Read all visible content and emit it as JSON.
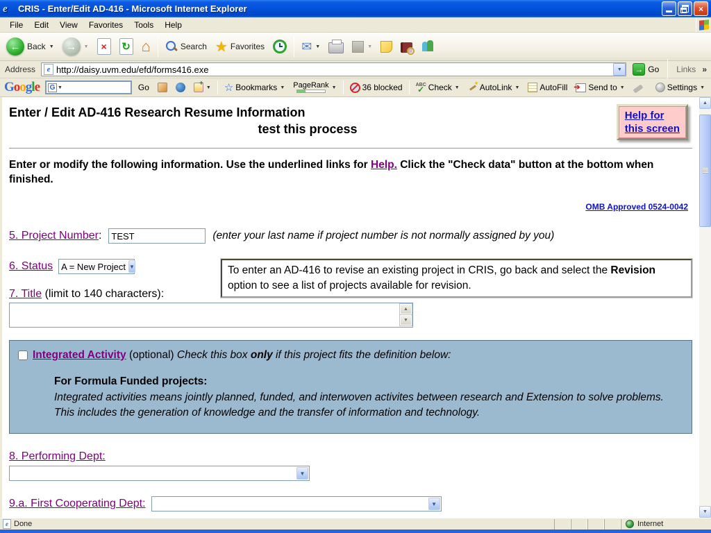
{
  "colors": {
    "titlebar_blue": "#0353dd",
    "chrome_tan": "#ece9d8",
    "link_blue": "#1111cc",
    "visited_purple": "#800080",
    "help_box_pink": "#ffcccc",
    "integrated_box_blue": "#9cbacf",
    "taskbar_blue": "#2663e0"
  },
  "window": {
    "title": "CRIS - Enter/Edit AD-416 - Microsoft Internet Explorer",
    "status_done": "Done",
    "status_zone": "Internet"
  },
  "menu": {
    "items": [
      "File",
      "Edit",
      "View",
      "Favorites",
      "Tools",
      "Help"
    ]
  },
  "toolbar": {
    "back_label": "Back",
    "search_label": "Search",
    "favorites_label": "Favorites"
  },
  "address": {
    "label": "Address",
    "url": "http://daisy.uvm.edu/efd/forms416.exe",
    "go_label": "Go",
    "links_label": "Links"
  },
  "google": {
    "logo_letters": [
      "G",
      "o",
      "o",
      "g",
      "l",
      "e"
    ],
    "favicon_letter": "G",
    "go_label": "Go",
    "bookmarks_label": "Bookmarks",
    "pagerank_label": "PageRank",
    "blocked_label": "36 blocked",
    "check_abc": "ABC",
    "check_label": "Check",
    "check_mark": "✓",
    "autolink_label": "AutoLink",
    "autofill_label": "AutoFill",
    "sendto_label": "Send to",
    "settings_label": "Settings"
  },
  "icons": {
    "ie_logo": "e",
    "close_x": "×",
    "back_arrow": "←",
    "forward_arrow": "→",
    "stop_x": "×",
    "refresh": "↻",
    "home": "⌂",
    "favorites_star": "★",
    "mail_envelope": "✉",
    "dropdown": "▼",
    "go_arrow": "→",
    "links_chevron": "»",
    "bookmarks_star": "☆",
    "scroll_up": "▲",
    "scroll_down": "▼"
  },
  "page": {
    "heading": "Enter / Edit AD-416 Research Resume Information",
    "subheading": "test this process",
    "help_line1": "Help for",
    "help_line2": "this screen",
    "intro_pre": "Enter or modify the following information. Use the underlined links for ",
    "intro_link": "Help.",
    "intro_post": " Click the \"Check data\" button at the bottom when finished.",
    "omb": "OMB Approved 0524-0042",
    "q5": {
      "label": "5. Project Number",
      "suffix": ":",
      "value": "TEST",
      "note": "(enter your last name if project number is not normally assigned by you)"
    },
    "q6": {
      "label": "6. Status",
      "selected": "A = New Project",
      "notice_pre": "To enter an AD-416 to revise an existing project in CRIS, go back and select the ",
      "notice_bold": "Revision",
      "notice_post": " option to see a list of projects available for revision."
    },
    "q7": {
      "label": "7. Title",
      "limit": " (limit to 140 characters):"
    },
    "integrated": {
      "link": "Integrated Activity",
      "optional": " (optional) ",
      "italic_pre": "Check this box ",
      "italic_bold": "only",
      "italic_post": " if this project fits the definition below:",
      "formula_head": "For Formula Funded projects:",
      "formula_text": "Integrated activities means jointly planned, funded, and interwoven activites between research and Extension to solve problems. This includes the generation of knowledge and the transfer of information and technology."
    },
    "q8": {
      "label": "8. Performing Dept:"
    },
    "q9a": {
      "label": "9.a. First Cooperating Dept:"
    }
  }
}
